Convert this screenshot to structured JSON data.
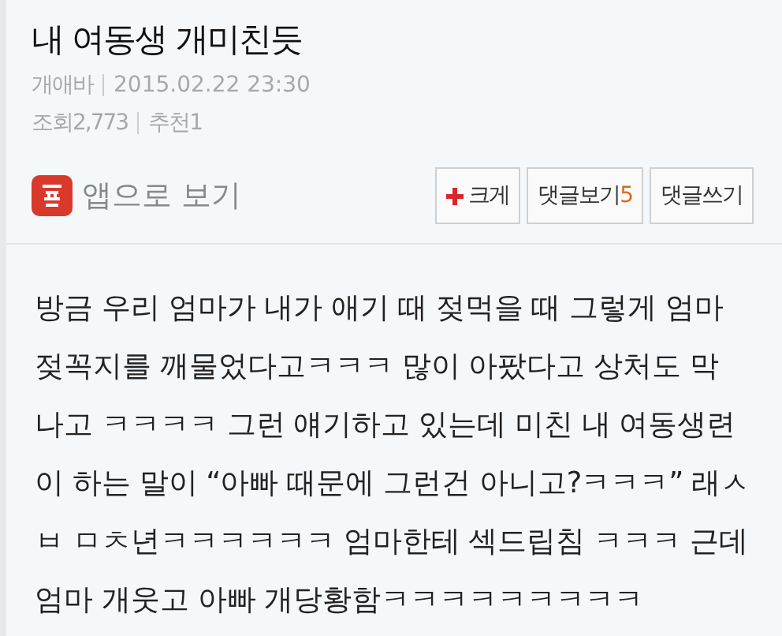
{
  "post": {
    "title": "내 여동생 개미친듯",
    "author": "개애바",
    "date": "2015.02.22 23:30",
    "views": "조회2,773",
    "recommend": "추천1"
  },
  "app_link": {
    "label": "앱으로 보기"
  },
  "buttons": [
    {
      "kind": "zoom",
      "label": "크게"
    },
    {
      "kind": "comments",
      "label": "댓글보기",
      "count": "5"
    },
    {
      "kind": "write",
      "label": "댓글쓰기"
    }
  ],
  "body": "방금 우리 엄마가 내가 애기 때 젖먹을 때 그렇게 엄마 젖꼭지를 깨물었다고ㅋㅋㅋ 많이 아팠다고 상처도 막 나고 ㅋㅋㅋㅋ 그런 얘기하고 있는데 미친 내 여동생련이 하는 말이 “아빠 때문에 그런건 아니고?ㅋㅋㅋ” 래ㅅㅂ ㅁㅊ년ㅋㅋㅋㅋㅋㅋ 엄마한테 섹드립침 ㅋㅋㅋ 근데 엄마 개웃고 아빠 개당황함ㅋㅋㅋㅋㅋㅋㅋㅋㅋ"
}
